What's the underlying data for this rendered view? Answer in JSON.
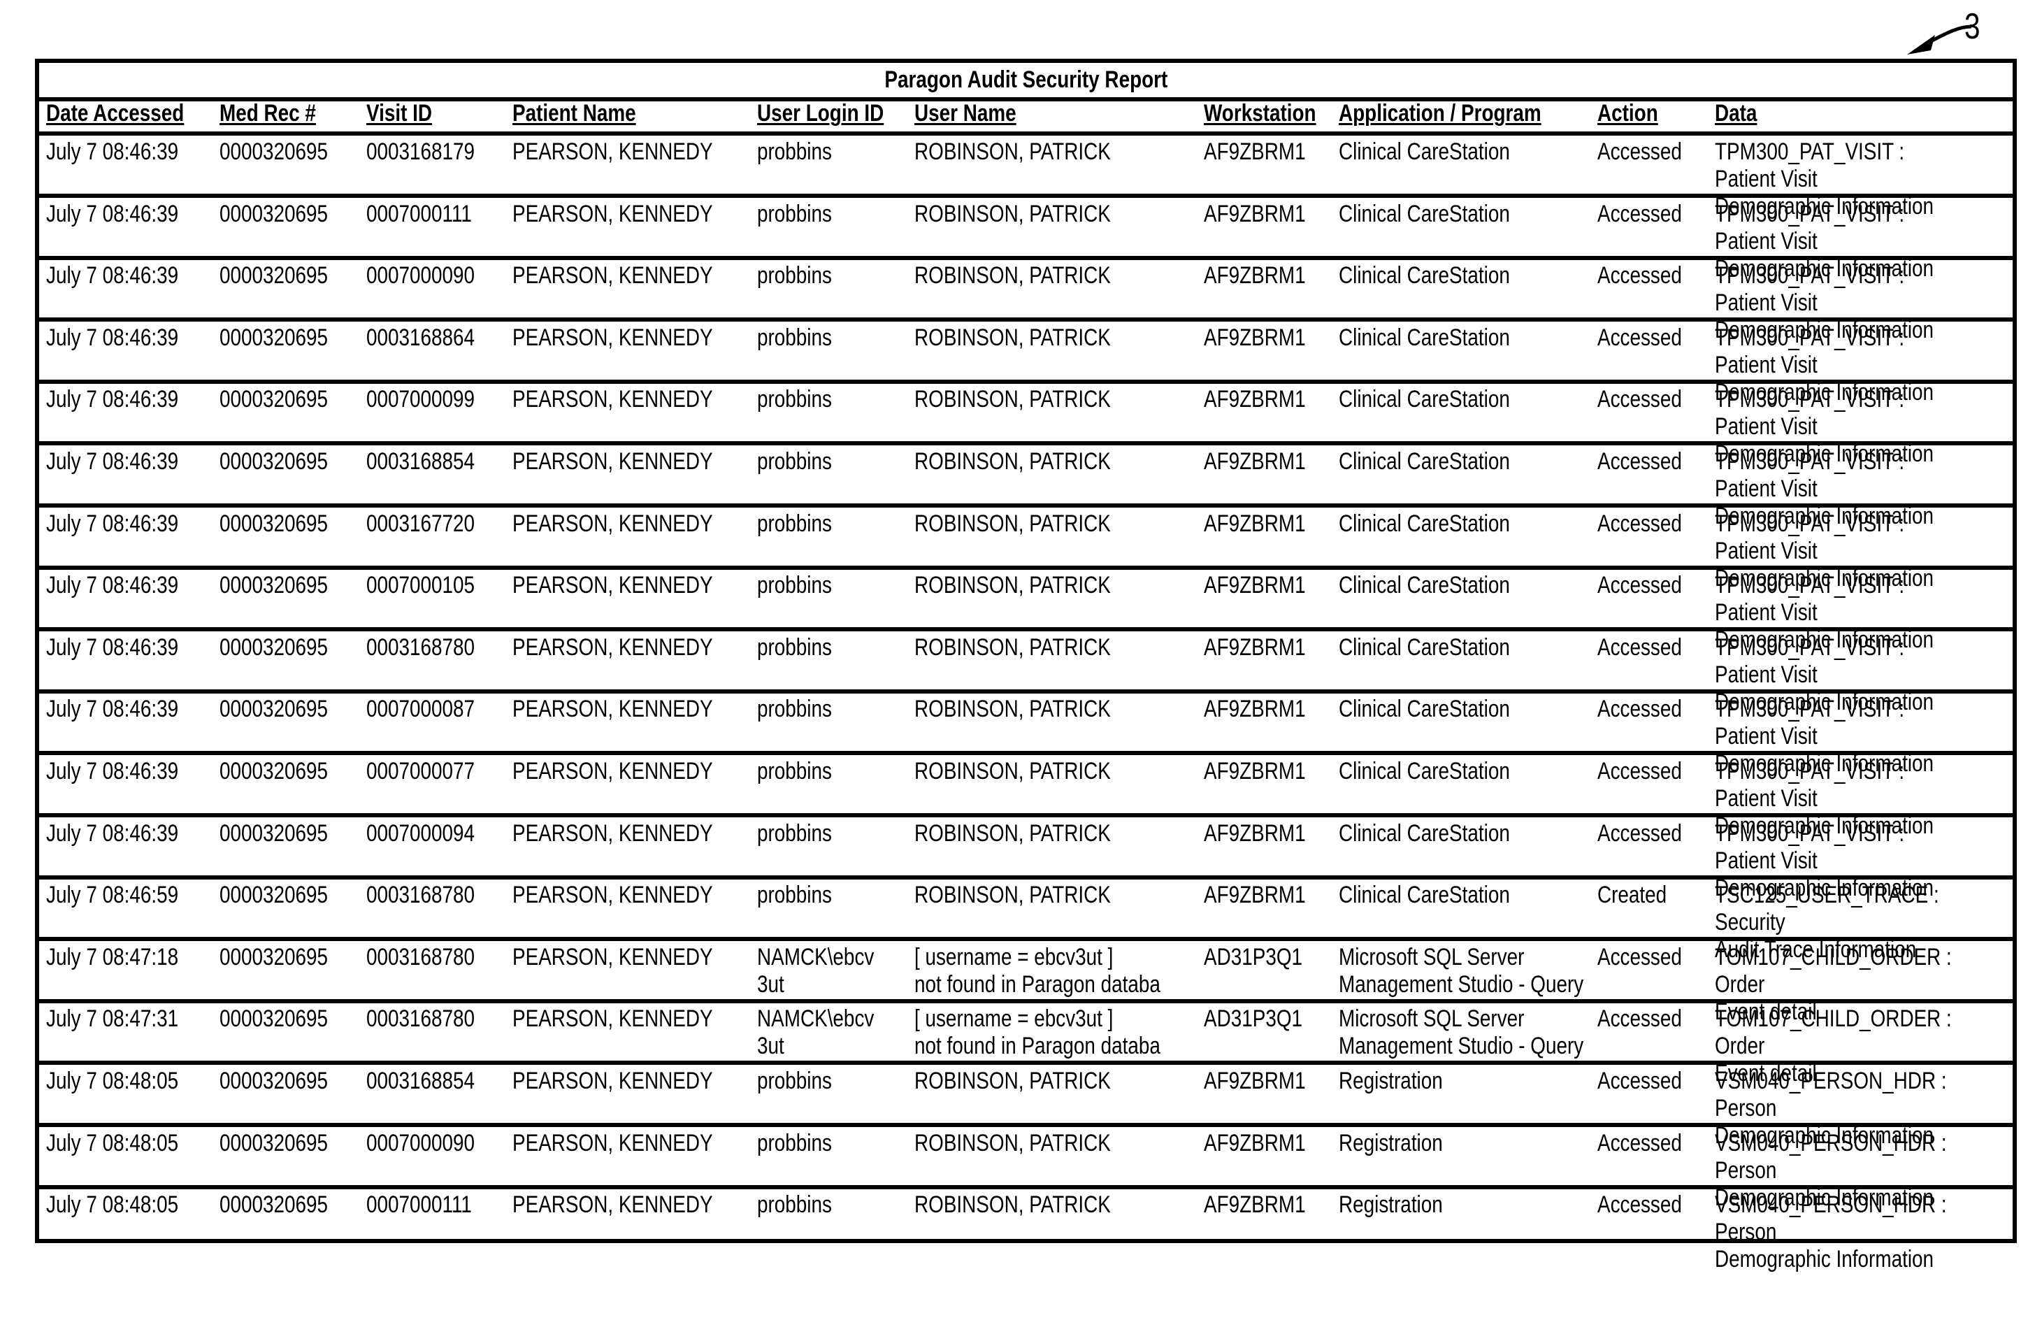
{
  "figure_reference": "3",
  "report": {
    "title": "Paragon Audit Security Report",
    "columns": [
      "Date Accessed",
      "Med Rec #",
      "Visit ID",
      "Patient Name",
      "User Login ID",
      "User Name",
      "Workstation",
      "Application / Program",
      "Action",
      "Data"
    ],
    "rows": [
      [
        "July 7 08:46:39",
        "0000320695",
        "0003168179",
        "PEARSON, KENNEDY",
        "probbins",
        "ROBINSON, PATRICK",
        "AF9ZBRM1",
        "Clinical CareStation",
        "Accessed",
        "TPM300_PAT_VISIT : Patient Visit\nDemographic Information"
      ],
      [
        "July 7 08:46:39",
        "0000320695",
        "0007000111",
        "PEARSON, KENNEDY",
        "probbins",
        "ROBINSON, PATRICK",
        "AF9ZBRM1",
        "Clinical CareStation",
        "Accessed",
        "TPM300_PAT_VISIT : Patient Visit\nDemographic Information"
      ],
      [
        "July 7 08:46:39",
        "0000320695",
        "0007000090",
        "PEARSON, KENNEDY",
        "probbins",
        "ROBINSON, PATRICK",
        "AF9ZBRM1",
        "Clinical CareStation",
        "Accessed",
        "TPM300_PAT_VISIT : Patient Visit\nDemographic Information"
      ],
      [
        "July 7 08:46:39",
        "0000320695",
        "0003168864",
        "PEARSON, KENNEDY",
        "probbins",
        "ROBINSON, PATRICK",
        "AF9ZBRM1",
        "Clinical CareStation",
        "Accessed",
        "TPM300_PAT_VISIT : Patient Visit\nDemographic Information"
      ],
      [
        "July 7 08:46:39",
        "0000320695",
        "0007000099",
        "PEARSON, KENNEDY",
        "probbins",
        "ROBINSON, PATRICK",
        "AF9ZBRM1",
        "Clinical CareStation",
        "Accessed",
        "TPM300_PAT_VISIT : Patient Visit\nDemographic Information"
      ],
      [
        "July 7 08:46:39",
        "0000320695",
        "0003168854",
        "PEARSON, KENNEDY",
        "probbins",
        "ROBINSON, PATRICK",
        "AF9ZBRM1",
        "Clinical CareStation",
        "Accessed",
        "TPM300_PAT_VISIT : Patient Visit\nDemographic Information"
      ],
      [
        "July 7 08:46:39",
        "0000320695",
        "0003167720",
        "PEARSON, KENNEDY",
        "probbins",
        "ROBINSON, PATRICK",
        "AF9ZBRM1",
        "Clinical CareStation",
        "Accessed",
        "TPM300_PAT_VISIT : Patient Visit\nDemographic Information"
      ],
      [
        "July 7 08:46:39",
        "0000320695",
        "0007000105",
        "PEARSON, KENNEDY",
        "probbins",
        "ROBINSON, PATRICK",
        "AF9ZBRM1",
        "Clinical CareStation",
        "Accessed",
        "TPM300_PAT_VISIT : Patient Visit\nDemographic Information"
      ],
      [
        "July 7 08:46:39",
        "0000320695",
        "0003168780",
        "PEARSON, KENNEDY",
        "probbins",
        "ROBINSON, PATRICK",
        "AF9ZBRM1",
        "Clinical CareStation",
        "Accessed",
        "TPM300_PAT_VISIT : Patient Visit\nDemographic Information"
      ],
      [
        "July 7 08:46:39",
        "0000320695",
        "0007000087",
        "PEARSON, KENNEDY",
        "probbins",
        "ROBINSON, PATRICK",
        "AF9ZBRM1",
        "Clinical CareStation",
        "Accessed",
        "TPM300_PAT_VISIT : Patient Visit\nDemographic Information"
      ],
      [
        "July 7 08:46:39",
        "0000320695",
        "0007000077",
        "PEARSON, KENNEDY",
        "probbins",
        "ROBINSON, PATRICK",
        "AF9ZBRM1",
        "Clinical CareStation",
        "Accessed",
        "TPM300_PAT_VISIT : Patient Visit\nDemographic Information"
      ],
      [
        "July 7 08:46:39",
        "0000320695",
        "0007000094",
        "PEARSON, KENNEDY",
        "probbins",
        "ROBINSON, PATRICK",
        "AF9ZBRM1",
        "Clinical CareStation",
        "Accessed",
        "TPM300_PAT_VISIT : Patient Visit\nDemographic Information"
      ],
      [
        "July 7 08:46:59",
        "0000320695",
        "0003168780",
        "PEARSON, KENNEDY",
        "probbins",
        "ROBINSON, PATRICK",
        "AF9ZBRM1",
        "Clinical CareStation",
        "Created",
        "TSC125_USER_TRACE : Security\nAudit Trace Information"
      ],
      [
        "July 7 08:47:18",
        "0000320695",
        "0003168780",
        "PEARSON, KENNEDY",
        "NAMCK\\ebcv\n3ut",
        "[ username = ebcv3ut ]\nnot found in Paragon databa",
        "AD31P3Q1",
        "Microsoft SQL Server\nManagement Studio - Query",
        "Accessed",
        "TOM107_CHILD_ORDER : Order\nEvent detail"
      ],
      [
        "July 7 08:47:31",
        "0000320695",
        "0003168780",
        "PEARSON, KENNEDY",
        "NAMCK\\ebcv\n3ut",
        "[ username = ebcv3ut ]\nnot found in Paragon databa",
        "AD31P3Q1",
        "Microsoft SQL Server\nManagement Studio - Query",
        "Accessed",
        "TOM107_CHILD_ORDER : Order\nEvent detail"
      ],
      [
        "July 7 08:48:05",
        "0000320695",
        "0003168854",
        "PEARSON, KENNEDY",
        "probbins",
        "ROBINSON, PATRICK",
        "AF9ZBRM1",
        "Registration",
        "Accessed",
        "VSM040_PERSON_HDR : Person\nDemographic Information"
      ],
      [
        "July 7 08:48:05",
        "0000320695",
        "0007000090",
        "PEARSON, KENNEDY",
        "probbins",
        "ROBINSON, PATRICK",
        "AF9ZBRM1",
        "Registration",
        "Accessed",
        "VSM040_PERSON_HDR : Person\nDemographic Information"
      ],
      [
        "July 7 08:48:05",
        "0000320695",
        "0007000111",
        "PEARSON, KENNEDY",
        "probbins",
        "ROBINSON, PATRICK",
        "AF9ZBRM1",
        "Registration",
        "Accessed",
        "VSM040_PERSON_HDR : Person\nDemographic Information"
      ]
    ]
  }
}
